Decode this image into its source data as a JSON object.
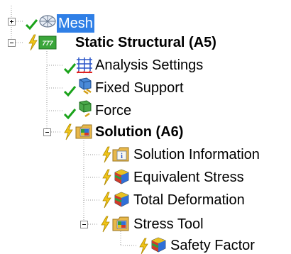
{
  "tree": {
    "mesh": {
      "label": "Mesh",
      "icon": "mesh-icon"
    },
    "static_structural": {
      "label": "Static Structural (A5)",
      "icon": "static-structural-icon"
    },
    "analysis_settings": {
      "label": "Analysis Settings",
      "icon": "analysis-settings-icon"
    },
    "fixed_support": {
      "label": "Fixed Support",
      "icon": "fixed-support-icon"
    },
    "force": {
      "label": "Force",
      "icon": "force-icon"
    },
    "solution": {
      "label": "Solution (A6)",
      "icon": "solution-folder-icon"
    },
    "solution_information": {
      "label": "Solution Information",
      "icon": "solution-information-icon"
    },
    "equivalent_stress": {
      "label": "Equivalent Stress",
      "icon": "equivalent-stress-icon"
    },
    "total_deformation": {
      "label": "Total Deformation",
      "icon": "total-deformation-icon"
    },
    "stress_tool": {
      "label": "Stress Tool",
      "icon": "stress-tool-folder-icon"
    },
    "safety_factor": {
      "label": "Safety Factor",
      "icon": "safety-factor-icon"
    }
  },
  "colors": {
    "selection": "#2f7fe6",
    "check_green": "#1aa31a",
    "lightning_yellow": "#f0c419",
    "tree_lines": "#9a9a9a"
  }
}
